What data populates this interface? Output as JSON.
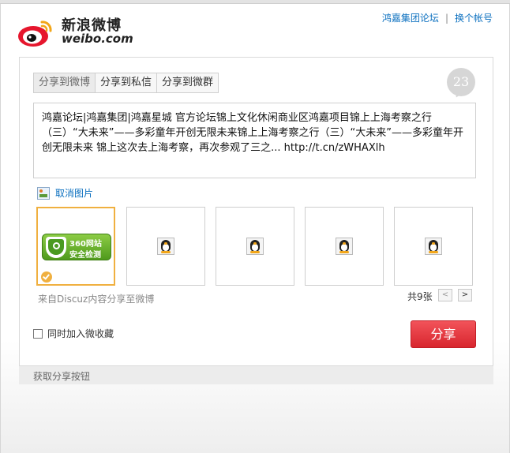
{
  "header": {
    "logo_cn": "新浪微博",
    "logo_en": "weibo.com",
    "account_name": "鸿嘉集团论坛",
    "separator": "|",
    "switch_account": "换个帐号"
  },
  "tabs": [
    {
      "label": "分享到微博",
      "active": true
    },
    {
      "label": "分享到私信",
      "active": false
    },
    {
      "label": "分享到微群",
      "active": false
    }
  ],
  "counter": "23",
  "share_text": "鸿嘉论坛|鸿嘉集团|鸿嘉星城 官方论坛锦上文化休闲商业区鸿嘉项目锦上上海考察之行（三）“大未来”——多彩童年开创无限未来锦上上海考察之行（三）“大未来”——多彩童年开创无限未来 锦上这次去上海考察，再次参观了三之... http://t.cn/zWHAXlh",
  "cancel_image": "取消图片",
  "thumbs": {
    "badge_line1": "360网站",
    "badge_line2": "安全检测",
    "first_thumb_icon": "360-site-security-badge",
    "placeholder_icon": "qq-penguin-icon"
  },
  "source_note": "来自Discuz内容分享至微博",
  "image_count": "共9张",
  "pager": {
    "prev": "<",
    "next": ">"
  },
  "favorite_label": "同时加入微收藏",
  "share_button": "分享",
  "footer_link": "获取分享按钮",
  "colors": {
    "link": "#0a6fbf",
    "share_button": "#e3343c",
    "selected_border": "#f0b040",
    "badge_green": "#5aa82a"
  }
}
